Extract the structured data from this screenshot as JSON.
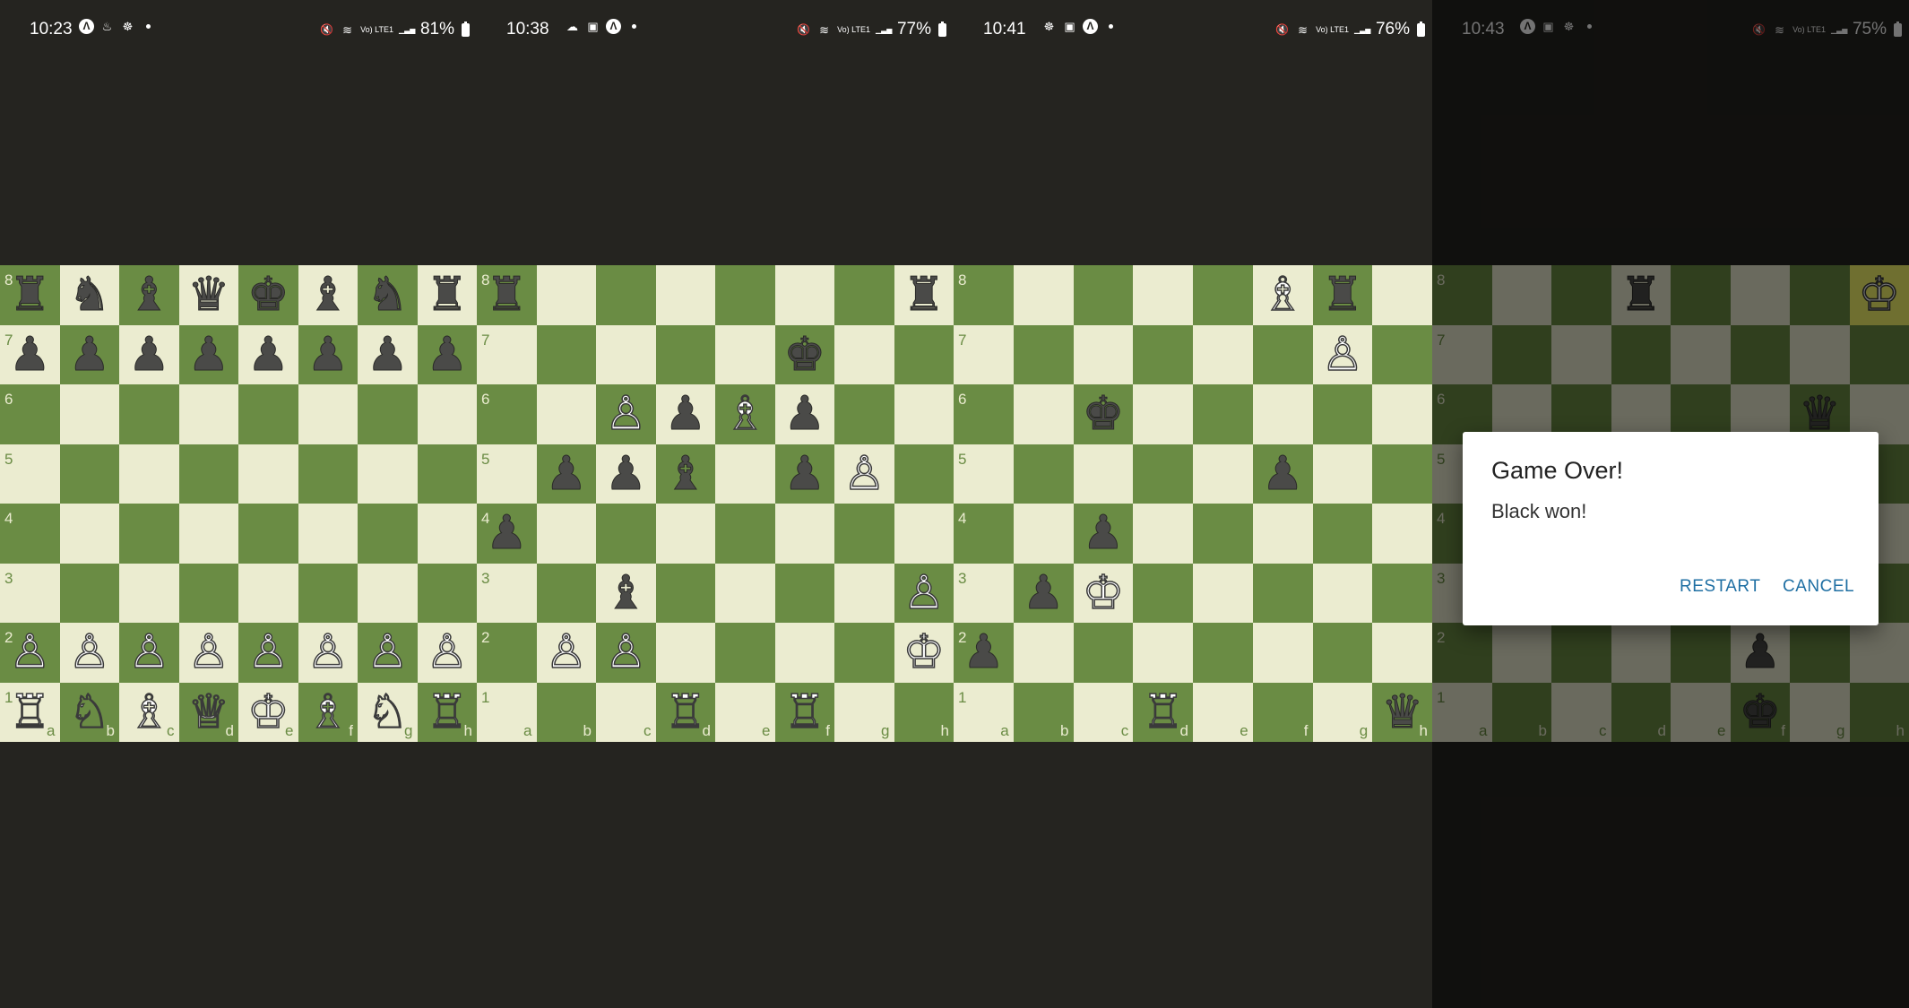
{
  "panels": [
    {
      "status": {
        "time": "10:23",
        "icons": [
          "Λ",
          "♨",
          "☸"
        ],
        "battery": "81%"
      },
      "files_row": [
        "a",
        "b",
        "c",
        "d",
        "e",
        "f",
        "g",
        "h"
      ],
      "pieces": {
        "a8": "br",
        "b8": "bn",
        "c8": "bb",
        "d8": "bq",
        "e8": "bk",
        "f8": "bb",
        "g8": "bn",
        "h8": "br",
        "a7": "bp",
        "b7": "bp",
        "c7": "bp",
        "d7": "bp",
        "e7": "bp",
        "f7": "bp",
        "g7": "bp",
        "h7": "bp",
        "a2": "wp",
        "b2": "wp",
        "c2": "wp",
        "d2": "wp",
        "e2": "wp",
        "f2": "wp",
        "g2": "wp",
        "h2": "wp",
        "a1": "wr",
        "b1": "wn",
        "c1": "wb",
        "d1": "wq",
        "e1": "wk",
        "f1": "wb",
        "g1": "wn",
        "h1": "wr"
      }
    },
    {
      "status": {
        "time": "10:38",
        "icons": [
          "☁",
          "▣",
          "Λ"
        ],
        "battery": "77%"
      },
      "files_row": [
        "a",
        "b",
        "c",
        "d",
        "e",
        "f",
        "g",
        "h"
      ],
      "pieces": {
        "a8": "br",
        "h8": "br",
        "f7": "bk",
        "c6": "wp",
        "d6": "bp",
        "e6": "wb",
        "f6": "bp",
        "b5": "bp",
        "c5": "bp",
        "d5": "bb",
        "f5": "bp",
        "g5": "wp",
        "a4": "bp",
        "c3": "bb",
        "h3": "wp",
        "b2": "wp",
        "c2": "wp",
        "h2": "wk",
        "d1": "wr",
        "f1": "wr"
      }
    },
    {
      "status": {
        "time": "10:41",
        "icons": [
          "☸",
          "▣",
          "Λ"
        ],
        "battery": "76%"
      },
      "files_row": [
        "a",
        "b",
        "c",
        "d",
        "e",
        "f",
        "g",
        "h"
      ],
      "pieces": {
        "f8": "wb",
        "g8": "br",
        "g7": "wp",
        "c6": "bk",
        "f5": "bp",
        "c4": "bp",
        "b3": "bp",
        "c3": "wk",
        "a2": "bp",
        "d1": "wr",
        "h1": "bq"
      }
    },
    {
      "status": {
        "time": "10:43",
        "icons": [
          "Λ",
          "▣",
          "☸"
        ],
        "battery": "75%"
      },
      "files_row": [
        "a",
        "b",
        "c",
        "d",
        "e",
        "f",
        "g",
        "h"
      ],
      "pieces": {
        "d8": "br",
        "h8": "wk",
        "g6": "bq",
        "f2": "bp",
        "f1": "bk"
      },
      "highlight": [
        "h8"
      ],
      "dialog": {
        "title": "Game Over!",
        "message": "Black won!",
        "restart_label": "RESTART",
        "cancel_label": "CANCEL"
      }
    }
  ],
  "status_common": {
    "signal_text": "Vo) LTE1"
  }
}
